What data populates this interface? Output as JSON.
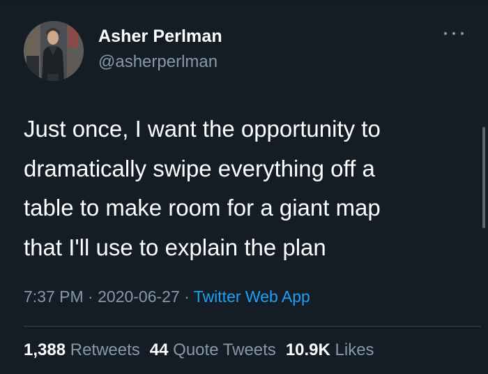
{
  "author": {
    "name": "Asher Perlman",
    "handle": "@asherperlman",
    "avatar_icon": "profile-photo"
  },
  "tweet": {
    "lines": [
      "Just once, I want the opportunity to",
      "dramatically swipe everything off a",
      "table to make room for a giant map",
      "that I'll use to explain the plan"
    ]
  },
  "meta": {
    "time": "7:37 PM",
    "sep1": " · ",
    "date": "2020-06-27",
    "sep2": " · ",
    "source": "Twitter Web App"
  },
  "stats": {
    "retweets_count": "1,388",
    "retweets_label": "Retweets",
    "quotes_count": "44",
    "quotes_label": "Quote Tweets",
    "likes_count": "10.9K",
    "likes_label": "Likes"
  },
  "colors": {
    "background": "#141d26",
    "secondary_text": "#8899a6",
    "accent": "#1da1f2"
  }
}
